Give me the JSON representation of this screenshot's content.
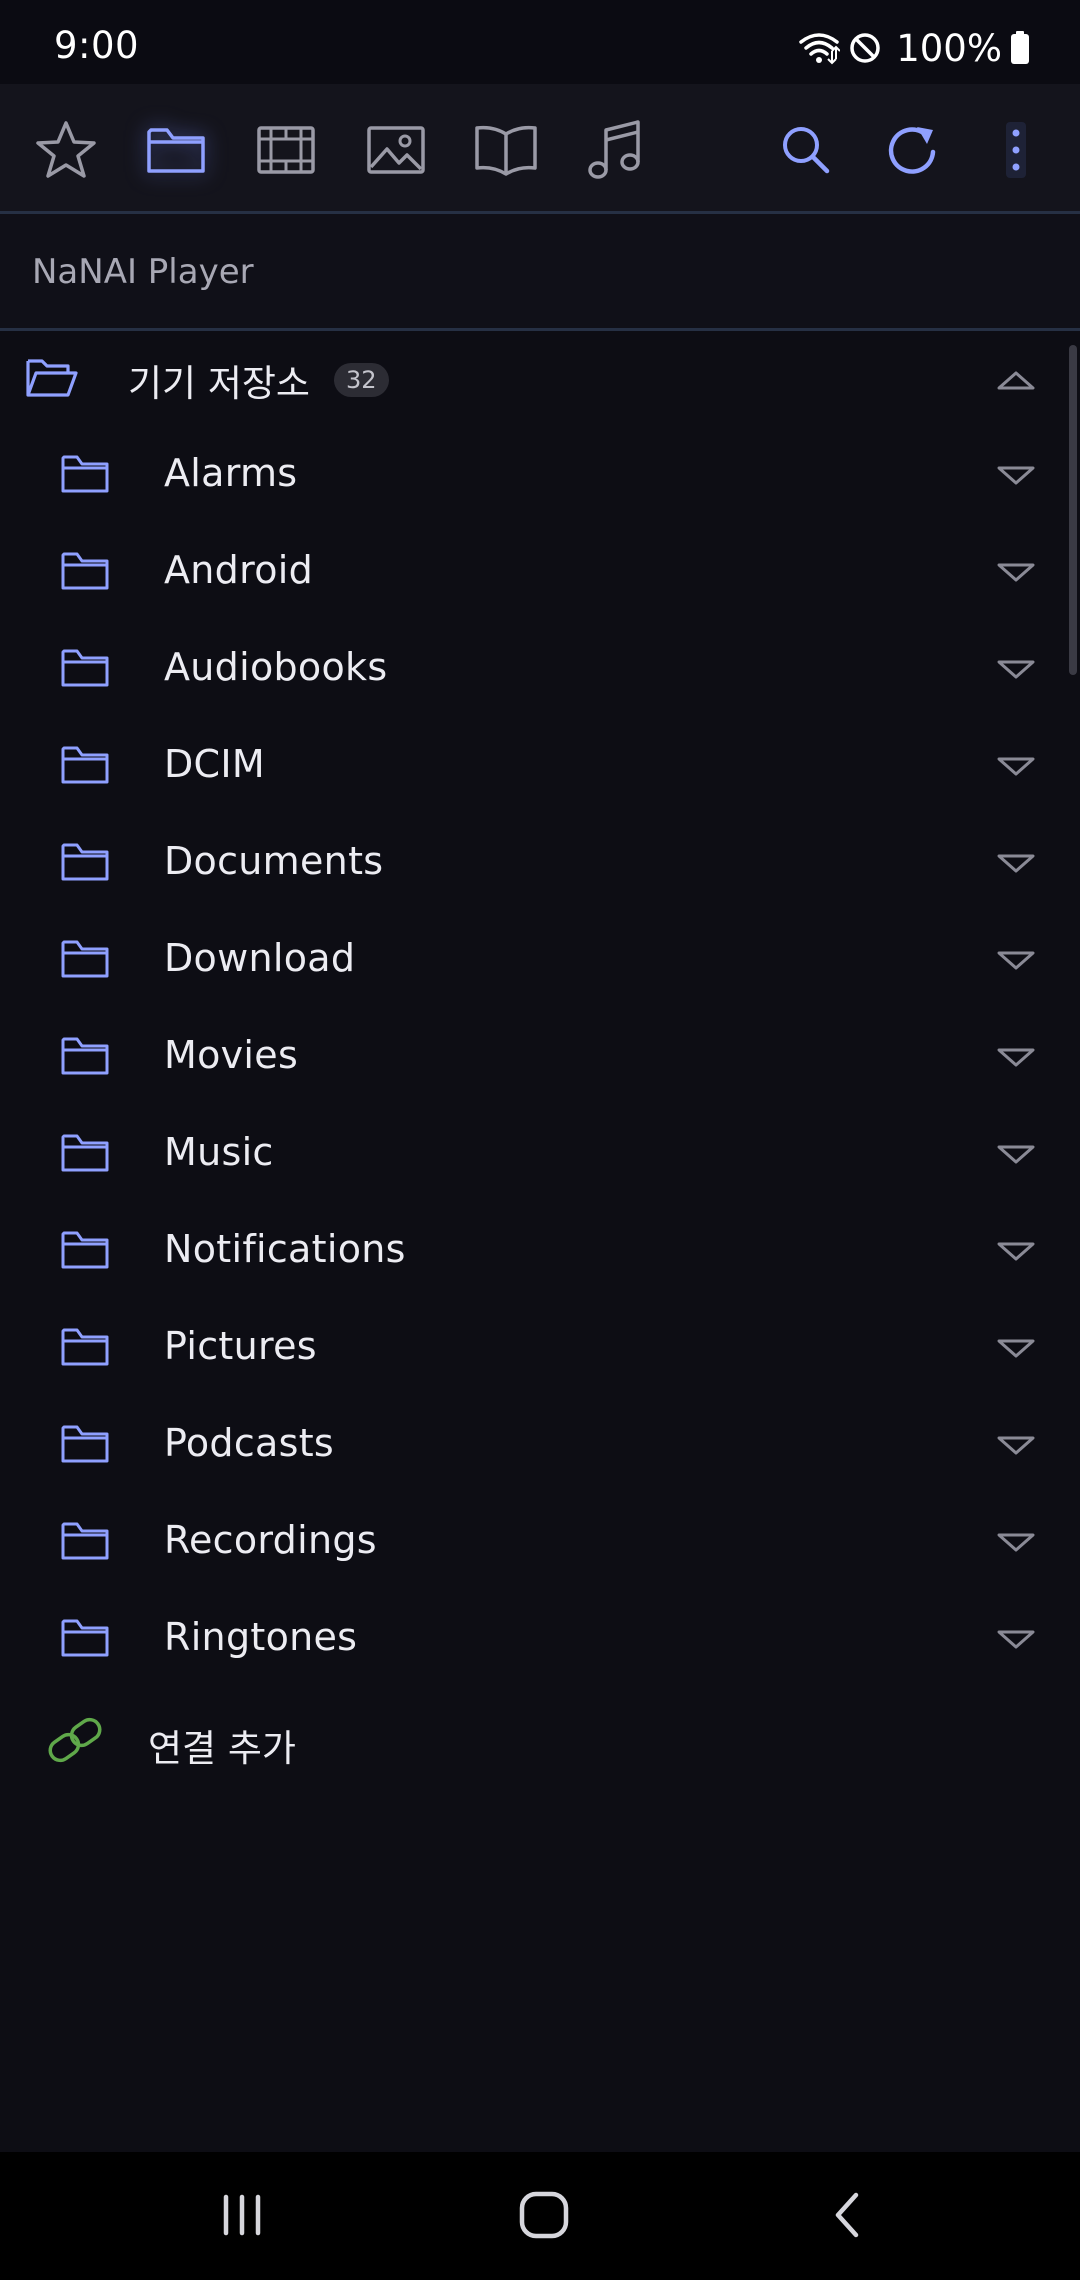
{
  "status_bar": {
    "time": "9:00",
    "battery": "100%",
    "icons": [
      "wifi-icon",
      "do-not-disturb-icon",
      "battery-icon"
    ]
  },
  "toolbar": {
    "tools": [
      {
        "icon": "star-icon",
        "active": false
      },
      {
        "icon": "folder-icon",
        "active": true
      },
      {
        "icon": "film-icon",
        "active": false
      },
      {
        "icon": "image-icon",
        "active": false
      },
      {
        "icon": "book-icon",
        "active": false
      },
      {
        "icon": "music-note-icon",
        "active": false
      },
      {
        "icon": "search-icon",
        "active": false
      },
      {
        "icon": "refresh-icon",
        "active": false
      },
      {
        "icon": "more-vert-icon",
        "active": false
      }
    ]
  },
  "app": {
    "title": "NaNAI Player"
  },
  "storage": {
    "label": "기기 저장소",
    "count": "32",
    "expanded": true
  },
  "folders": [
    {
      "name": "Alarms"
    },
    {
      "name": "Android"
    },
    {
      "name": "Audiobooks"
    },
    {
      "name": "DCIM"
    },
    {
      "name": "Documents"
    },
    {
      "name": "Download"
    },
    {
      "name": "Movies"
    },
    {
      "name": "Music"
    },
    {
      "name": "Notifications"
    },
    {
      "name": "Pictures"
    },
    {
      "name": "Podcasts"
    },
    {
      "name": "Recordings"
    },
    {
      "name": "Ringtones"
    }
  ],
  "add_connection": {
    "label": "연결 추가"
  },
  "colors": {
    "accent": "#8fa0ff",
    "icon_grey": "#9a9aa6",
    "link_green": "#5fa84a",
    "background": "#0d0d14"
  },
  "nav_bar": {
    "buttons": [
      "recents-icon",
      "home-icon",
      "back-icon"
    ]
  }
}
